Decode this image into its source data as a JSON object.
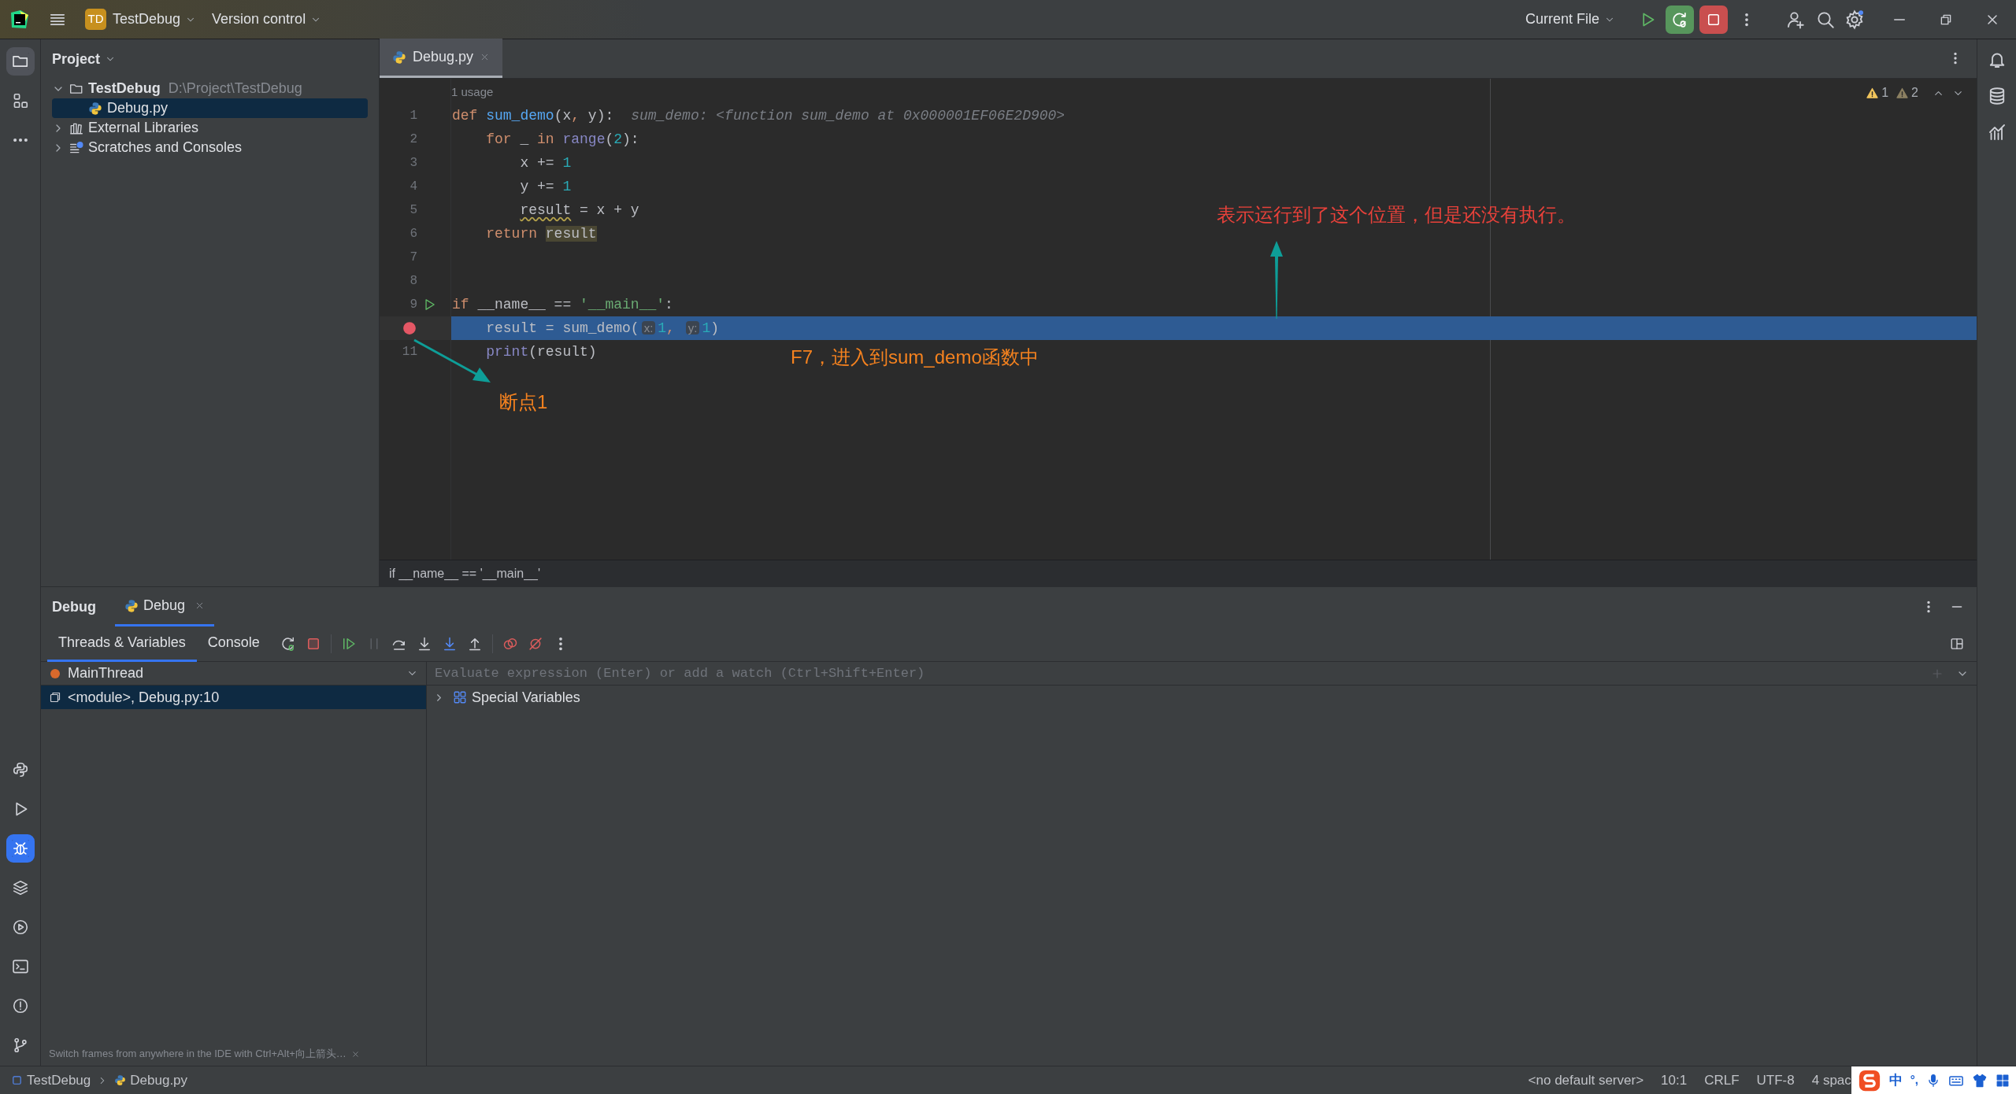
{
  "title_bar": {
    "project_badge": "TD",
    "project": "TestDebug",
    "vcs": "Version control",
    "run_config": "Current File"
  },
  "left_toolbar": {
    "top": [
      {
        "kind": "folder",
        "selected": true
      },
      {
        "kind": "structure",
        "selected": false
      },
      {
        "kind": "more",
        "selected": false
      }
    ],
    "bottom": [
      {
        "kind": "python_console",
        "selected": false
      },
      {
        "kind": "run",
        "selected": false
      },
      {
        "kind": "debug",
        "selected": true
      },
      {
        "kind": "layers",
        "selected": false
      },
      {
        "kind": "services",
        "selected": false
      },
      {
        "kind": "terminal",
        "selected": false
      },
      {
        "kind": "problems",
        "selected": false
      },
      {
        "kind": "git",
        "selected": false
      }
    ]
  },
  "project_panel": {
    "title": "Project",
    "tree": [
      {
        "kind": "folder",
        "label": "TestDebug",
        "path": "D:\\Project\\TestDebug",
        "expanded": true,
        "selected": false,
        "children": [
          {
            "kind": "python",
            "label": "Debug.py",
            "selected": true
          }
        ]
      },
      {
        "kind": "library",
        "label": "External Libraries",
        "expanded": false,
        "selected": false
      },
      {
        "kind": "scratches",
        "label": "Scratches and Consoles",
        "expanded": false,
        "selected": false
      }
    ]
  },
  "editor": {
    "tabs": [
      {
        "label": "Debug.py",
        "selected": true
      }
    ],
    "usage_hint": "1 usage",
    "warnings": [
      {
        "kind": "warning",
        "count": "1"
      },
      {
        "kind": "weak_warning",
        "count": "2"
      }
    ],
    "lines": [
      {
        "number": "1",
        "current": false,
        "breakpoint": false,
        "run_icon": false,
        "tokens": [
          {
            "kind": "keyword",
            "text": "def "
          },
          {
            "kind": "function",
            "text": "sum_demo"
          },
          {
            "kind": "plain",
            "text": "(x"
          },
          {
            "kind": "keyword",
            "text": ", "
          },
          {
            "kind": "plain",
            "text": "y):"
          }
        ],
        "inline_value": "sum_demo: <function sum_demo at 0x000001EF06E2D900>",
        "children": [
          {
            "number": "2",
            "current": false,
            "breakpoint": false,
            "run_icon": false,
            "tokens": [
              {
                "kind": "keyword",
                "text": "for "
              },
              {
                "kind": "plain",
                "text": "_ "
              },
              {
                "kind": "keyword",
                "text": "in "
              },
              {
                "kind": "builtin",
                "text": "range"
              },
              {
                "kind": "plain",
                "text": "("
              },
              {
                "kind": "number",
                "text": "2"
              },
              {
                "kind": "plain",
                "text": "):"
              }
            ],
            "children": [
              {
                "number": "3",
                "current": false,
                "breakpoint": false,
                "run_icon": false,
                "tokens": [
                  {
                    "kind": "plain",
                    "text": "x += "
                  },
                  {
                    "kind": "number",
                    "text": "1"
                  }
                ]
              },
              {
                "number": "4",
                "current": false,
                "breakpoint": false,
                "run_icon": false,
                "tokens": [
                  {
                    "kind": "plain",
                    "text": "y += "
                  },
                  {
                    "kind": "number",
                    "text": "1"
                  }
                ]
              },
              {
                "number": "5",
                "current": false,
                "breakpoint": false,
                "run_icon": false,
                "tokens": [
                  {
                    "kind": "warning",
                    "text": "result"
                  },
                  {
                    "kind": "plain",
                    "text": " = x + y"
                  }
                ]
              }
            ]
          },
          {
            "number": "6",
            "current": false,
            "breakpoint": false,
            "run_icon": false,
            "tokens": [
              {
                "kind": "keyword",
                "text": "return "
              },
              {
                "kind": "highlight",
                "text": "result"
              }
            ]
          }
        ]
      },
      {
        "number": "7",
        "current": false,
        "breakpoint": false,
        "run_icon": false
      },
      {
        "number": "8",
        "current": false,
        "breakpoint": false,
        "run_icon": false
      },
      {
        "number": "9",
        "current": false,
        "breakpoint": false,
        "run_icon": true,
        "tokens": [
          {
            "kind": "keyword",
            "text": "if "
          },
          {
            "kind": "plain",
            "text": "__name__ == "
          },
          {
            "kind": "string",
            "text": "'__main__'"
          },
          {
            "kind": "plain",
            "text": ":"
          }
        ],
        "children": [
          {
            "current": true,
            "breakpoint": true,
            "run_icon": false,
            "tokens": [
              {
                "kind": "plain",
                "text": "result = sum_demo("
              },
              {
                "kind": "hint",
                "text": "x:"
              },
              {
                "kind": "number",
                "text": "1"
              },
              {
                "kind": "keyword",
                "text": ", "
              },
              {
                "kind": "hint",
                "text": "y:"
              },
              {
                "kind": "number",
                "text": "1"
              },
              {
                "kind": "plain",
                "text": ")"
              }
            ]
          },
          {
            "number": "11",
            "current": false,
            "breakpoint": false,
            "run_icon": false,
            "tokens": [
              {
                "kind": "builtin",
                "text": "print"
              },
              {
                "kind": "plain",
                "text": "(result)"
              }
            ]
          }
        ]
      }
    ],
    "breadcrumb": "if __name__ == '__main__'"
  },
  "annotations": [
    {
      "text": "表示运行到了这个位置，但是还没有执行。",
      "color": "#e8413a"
    },
    {
      "text": "F7，进入到sum_demo函数中",
      "color": "#f5821f"
    },
    {
      "text": "断点1",
      "color": "#f5821f"
    }
  ],
  "debug": {
    "title": "Debug",
    "tabs": [
      {
        "label": "Debug",
        "selected": true
      }
    ],
    "subtabs": [
      {
        "label": "Threads & Variables",
        "selected": true
      },
      {
        "label": "Console",
        "selected": false
      }
    ],
    "toolbar_groups": [
      {
        "buttons": [
          {
            "kind": "rerun",
            "disabled": false
          },
          {
            "kind": "stop",
            "disabled": false
          }
        ]
      },
      {
        "buttons": [
          {
            "kind": "resume",
            "disabled": false
          },
          {
            "kind": "pause",
            "disabled": true
          },
          {
            "kind": "step_over",
            "disabled": false
          },
          {
            "kind": "step_into",
            "disabled": false
          },
          {
            "kind": "step_into_my_code",
            "disabled": false
          },
          {
            "kind": "step_out",
            "disabled": false
          }
        ]
      },
      {
        "buttons": [
          {
            "kind": "view_breakpoints",
            "disabled": false
          },
          {
            "kind": "mute_breakpoints",
            "disabled": false
          },
          {
            "kind": "more",
            "disabled": false
          }
        ]
      }
    ],
    "thread": "MainThread",
    "frames": [
      {
        "label": "<module>, Debug.py:10",
        "selected": true
      }
    ],
    "evaluate": {
      "placeholder": "Evaluate expression (Enter) or add a watch (Ctrl+Shift+Enter)"
    },
    "variables": [
      {
        "label": "Special Variables",
        "expanded": false
      }
    ],
    "hint": "Switch frames from anywhere in the IDE with Ctrl+Alt+向上箭头…"
  },
  "status_bar": {
    "breadcrumbs": [
      {
        "kind": "module",
        "label": "TestDebug"
      },
      {
        "kind": "python",
        "label": "Debug.py"
      }
    ],
    "items": [
      "<no default server>",
      "10:1",
      "CRLF",
      "UTF-8",
      "4 spac"
    ]
  },
  "ime_toolbar": {
    "mode": "中",
    "punctuation": "°,"
  }
}
